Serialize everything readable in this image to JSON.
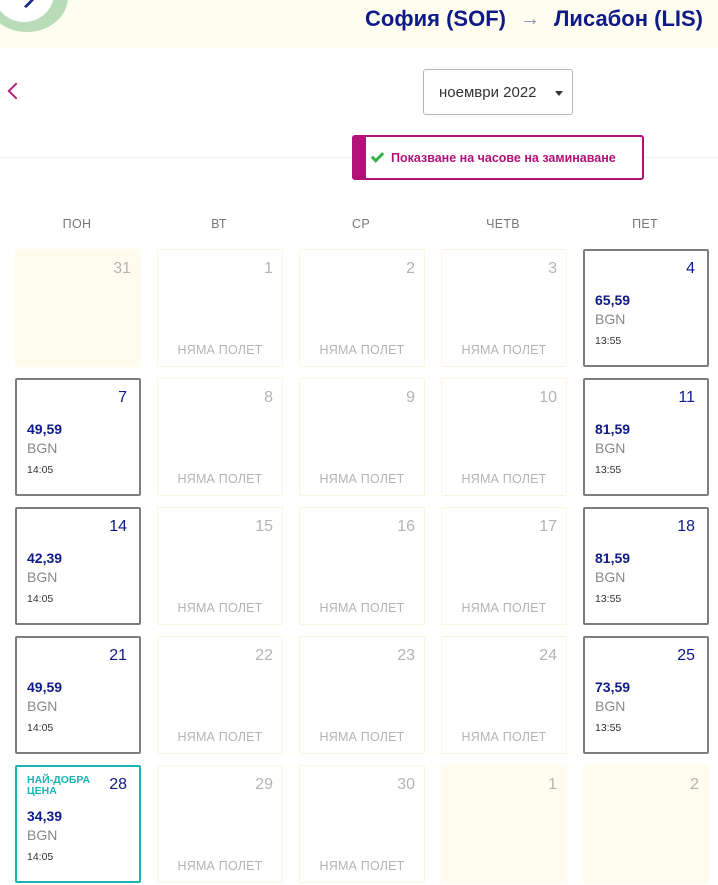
{
  "header": {
    "origin": "София (SOF)",
    "arrow": "→",
    "destination": "Лисабон (LIS)"
  },
  "month_select": {
    "value": "ноември 2022"
  },
  "toggle": {
    "label": "Показване на часове на заминаване"
  },
  "weekdays": [
    "ПОН",
    "ВТ",
    "СР",
    "ЧЕТВ",
    "ПЕТ"
  ],
  "no_flight_label": "НЯМА ПОЛЕТ",
  "currency": "BGN",
  "best_price_label": "НАЙ-ДОБРА ЦЕНА",
  "weeks": [
    [
      {
        "day": "31",
        "state": "other"
      },
      {
        "day": "1",
        "state": "noflight"
      },
      {
        "day": "2",
        "state": "noflight"
      },
      {
        "day": "3",
        "state": "noflight"
      },
      {
        "day": "4",
        "state": "avail",
        "price": "65,59",
        "time": "13:55"
      }
    ],
    [
      {
        "day": "7",
        "state": "avail",
        "price": "49,59",
        "time": "14:05"
      },
      {
        "day": "8",
        "state": "noflight"
      },
      {
        "day": "9",
        "state": "noflight"
      },
      {
        "day": "10",
        "state": "noflight"
      },
      {
        "day": "11",
        "state": "avail",
        "price": "81,59",
        "time": "13:55"
      }
    ],
    [
      {
        "day": "14",
        "state": "avail",
        "price": "42,39",
        "time": "14:05"
      },
      {
        "day": "15",
        "state": "noflight"
      },
      {
        "day": "16",
        "state": "noflight"
      },
      {
        "day": "17",
        "state": "noflight"
      },
      {
        "day": "18",
        "state": "avail",
        "price": "81,59",
        "time": "13:55"
      }
    ],
    [
      {
        "day": "21",
        "state": "avail",
        "price": "49,59",
        "time": "14:05"
      },
      {
        "day": "22",
        "state": "noflight"
      },
      {
        "day": "23",
        "state": "noflight"
      },
      {
        "day": "24",
        "state": "noflight"
      },
      {
        "day": "25",
        "state": "avail",
        "price": "73,59",
        "time": "13:55"
      }
    ],
    [
      {
        "day": "28",
        "state": "best",
        "price": "34,39",
        "time": "14:05"
      },
      {
        "day": "29",
        "state": "noflight"
      },
      {
        "day": "30",
        "state": "noflight"
      },
      {
        "day": "1",
        "state": "other"
      },
      {
        "day": "2",
        "state": "other"
      }
    ]
  ],
  "colors": {
    "brand_navy": "#0e1a86",
    "accent_magenta": "#b0127a",
    "best_teal": "#17b5b5",
    "check_green": "#35b34a"
  }
}
